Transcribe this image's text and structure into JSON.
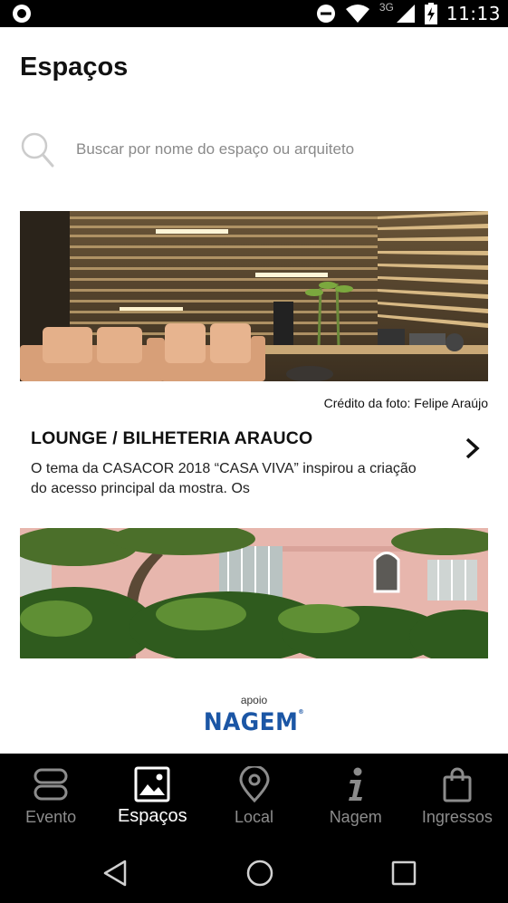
{
  "status_bar": {
    "network_label": "3G",
    "time": "11:13"
  },
  "header": {
    "title": "Espaços"
  },
  "search": {
    "placeholder": "Buscar por nome do espaço ou arquiteto",
    "icon": "search-icon"
  },
  "cards": [
    {
      "photo_credit": "Crédito da foto: Felipe Araújo",
      "title": "LOUNGE / BILHETERIA ARAUCO",
      "description": "O tema da CASACOR 2018 “CASA VIVA” inspirou a criação do acesso principal da mostra. Os"
    }
  ],
  "sponsor": {
    "label": "apoio",
    "logo_text": "NAGEM"
  },
  "tabs": [
    {
      "label": "Evento",
      "icon": "event-icon",
      "active": false
    },
    {
      "label": "Espaços",
      "icon": "image-icon",
      "active": true
    },
    {
      "label": "Local",
      "icon": "location-pin-icon",
      "active": false
    },
    {
      "label": "Nagem",
      "icon": "info-icon",
      "active": false
    },
    {
      "label": "Ingressos",
      "icon": "shopping-bag-icon",
      "active": false
    }
  ],
  "colors": {
    "brand_blue": "#1b56a5",
    "tab_bar_bg": "#000000",
    "tab_active": "#ffffff",
    "tab_inactive": "#8c8c8c"
  }
}
